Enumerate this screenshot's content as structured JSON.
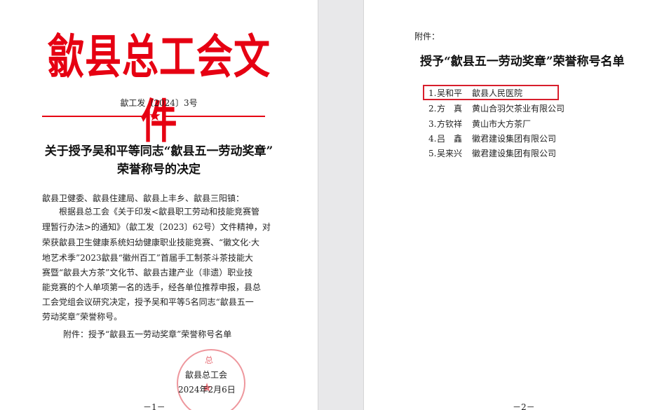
{
  "page1": {
    "masthead": "歙县总工会文件",
    "doc_number": "歙工发〔2024〕3号",
    "title_line1": "关于授予吴和平等同志“歙县五一劳动奖章”",
    "title_line2": "荣誉称号的决定",
    "addressee": "歙县卫健委、歙县住建局、歙县上丰乡、歙县三阳镇：",
    "body_lines": [
      "根据县总工会《关于印发<歙县职工劳动和技能竞赛管",
      "理暂行办法>的通知》（歙工发〔2023〕62号）文件精神，对",
      "荣获歙县卫生健康系统妇幼健康职业技能竞赛、“徽文化·大",
      "地艺术季”2023歙县“徽州百工”首届手工制茶斗茶技能大",
      "赛暨“歙县大方茶”文化节、歙县古建产业（非遗）职业技",
      "能竞赛的个人单项第一名的选手，经各单位推荐申报，县总",
      "工会党组会议研究决定，授予吴和平等5名同志“歙县五一",
      "劳动奖章”荣誉称号。"
    ],
    "attachment": "附件：授予“歙县五一劳动奖章”荣誉称号名单",
    "signature_org": "歙县总工会",
    "signature_date": "2024年2月6日",
    "seal_char": "总",
    "page_number": "－1－"
  },
  "page2": {
    "attachment_label": "附件：",
    "list_title": "授予“歙县五一劳动奖章”荣誉称号名单",
    "recipients": [
      {
        "num": "1.",
        "name": "吴和平",
        "org": "歙县人民医院"
      },
      {
        "num": "2.",
        "name": "方　真",
        "org": "黄山合羽欠茶业有限公司"
      },
      {
        "num": "3.",
        "name": "方钦祥",
        "org": "黄山市大方茶厂"
      },
      {
        "num": "4.",
        "name": "吕　鑫",
        "org": "徽君建设集团有限公司"
      },
      {
        "num": "5.",
        "name": "吴来兴",
        "org": "徽君建设集团有限公司"
      }
    ],
    "page_number": "－2－"
  },
  "colors": {
    "masthead_red": "#e60012",
    "highlight_box": "#d81e2c",
    "seal": "#e8747c"
  },
  "icons": [
    "star-icon",
    "seal-star-icon"
  ]
}
